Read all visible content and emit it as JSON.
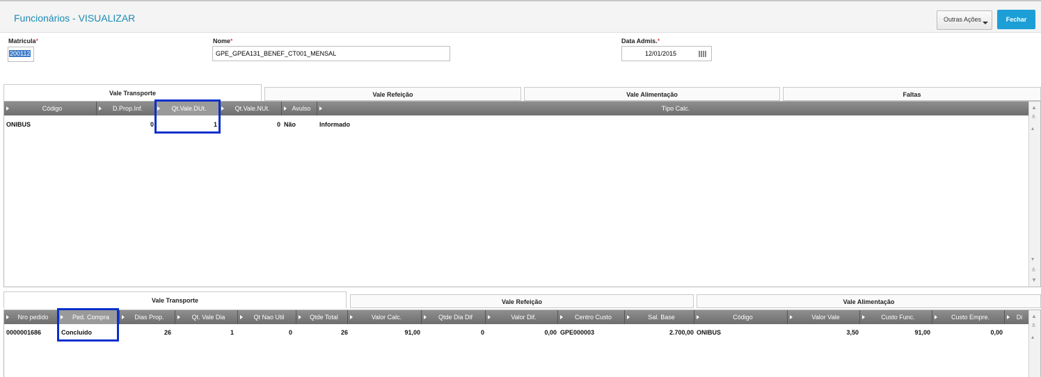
{
  "header": {
    "title": "Funcionários - VISUALIZAR",
    "outras_label": "Outras Ações",
    "fechar_label": "Fechar"
  },
  "form": {
    "matricula": {
      "label": "Matricula",
      "required": "*",
      "value": "200112"
    },
    "nome": {
      "label": "Nome",
      "required": "*",
      "value": "GPE_GPEA131_BENEF_CT001_MENSAL"
    },
    "data_admis": {
      "label": "Data Admis.",
      "required": "*",
      "value": "12/01/2015"
    }
  },
  "top_tabs": [
    "Vale Transporte",
    "Vale Refeição",
    "Vale Alimentação",
    "Faltas"
  ],
  "top_grid": {
    "headers": [
      "Código",
      "D.Prop.Inf.",
      "Qt.Vale.DUt.",
      "Qt.Vale.NUt.",
      "Avulso",
      "Tipo Calc."
    ],
    "row": [
      "ONIBUS",
      "0",
      "1",
      "0",
      "Não",
      "Informado"
    ]
  },
  "bottom_tabs": [
    "Vale Transporte",
    "Vale Refeição",
    "Vale Alimentação"
  ],
  "bottom_grid": {
    "headers": [
      "Nro pedido",
      "Ped. Compra",
      "Dias Prop.",
      "Qt. Vale Dia",
      "Qt Nao Util",
      "Qtde Total",
      "Valor Calc.",
      "Qtde Dia Dif",
      "Valor Dif.",
      "Centro Custo",
      "Sal. Base",
      "Código",
      "Valor Vale",
      "Custo Func.",
      "Custo Empre.",
      "Di"
    ],
    "row": [
      "0000001686",
      "Concluído",
      "26",
      "1",
      "0",
      "26",
      "91,00",
      "0",
      "0,00",
      "GPE000003",
      "2.700,00",
      "ONIBUS",
      "3,50",
      "91,00",
      "0,00",
      ""
    ]
  },
  "colors": {
    "accent": "#1c9fd6",
    "title": "#1a8ab4",
    "highlight_box": "#0a2fcc",
    "header_bg": "#7a7a7a"
  },
  "icons": {
    "calendar": "calendar-icon",
    "scroll_up": "scroll-up-icon",
    "scroll_down": "scroll-down-icon"
  }
}
